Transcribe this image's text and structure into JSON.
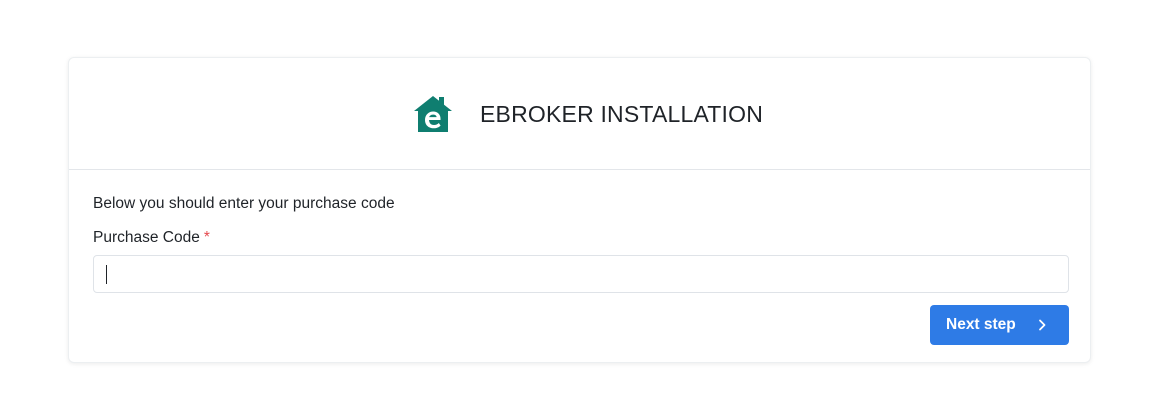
{
  "header": {
    "title": "EBROKER INSTALLATION",
    "logo_icon": "house-e-logo-icon",
    "logo_color": "#0f7e70"
  },
  "form": {
    "intro_text": "Below you should enter your purchase code",
    "purchase_code_label": "Purchase Code",
    "required_marker": "*",
    "purchase_code_value": "",
    "purchase_code_placeholder": ""
  },
  "actions": {
    "next_step_label": "Next step",
    "next_icon": "chevron-right-icon",
    "button_color": "#2e7be6"
  }
}
